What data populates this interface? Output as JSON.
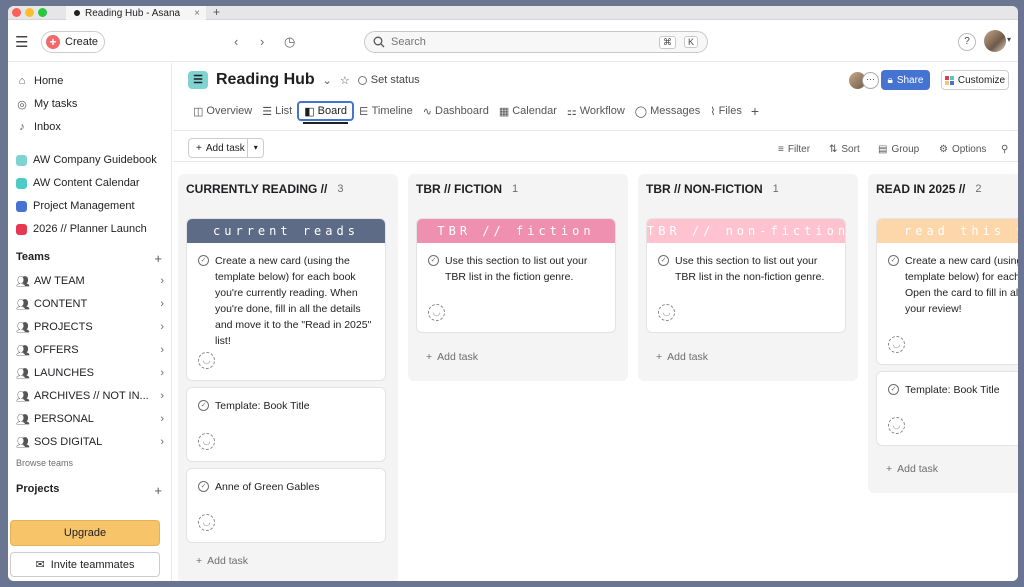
{
  "browser": {
    "tab_title": "Reading Hub - Asana"
  },
  "topbar": {
    "create_label": "Create",
    "search_placeholder": "Search",
    "kbd1": "⌘",
    "kbd2": "K",
    "help": "?"
  },
  "sidebar": {
    "top_items": [
      {
        "label": "Home",
        "icon": "home-icon"
      },
      {
        "label": "My tasks",
        "icon": "check-circle-icon"
      },
      {
        "label": "Inbox",
        "icon": "bell-icon"
      }
    ],
    "projects_top": [
      {
        "label": "AW Company Guidebook",
        "color": "#7fd3d1"
      },
      {
        "label": "AW Content Calendar",
        "color": "#4ecbc4"
      },
      {
        "label": "Project Management",
        "color": "#4573d2"
      },
      {
        "label": "2026 // Planner Launch",
        "color": "#e8384f"
      }
    ],
    "teams_title": "Teams",
    "teams": [
      "AW TEAM",
      "CONTENT",
      "PROJECTS",
      "OFFERS",
      "LAUNCHES",
      "ARCHIVES // NOT IN...",
      "PERSONAL",
      "SOS DIGITAL"
    ],
    "browse_teams": "Browse teams",
    "projects_title": "Projects",
    "upgrade": "Upgrade",
    "invite": "Invite teammates"
  },
  "project": {
    "title": "Reading Hub",
    "set_status": "Set status",
    "share": "Share",
    "customize": "Customize",
    "tabs": [
      "Overview",
      "List",
      "Board",
      "Timeline",
      "Dashboard",
      "Calendar",
      "Workflow",
      "Messages",
      "Files"
    ],
    "active_tab": "Board"
  },
  "toolbar": {
    "add_task": "Add task",
    "filter": "Filter",
    "sort": "Sort",
    "group": "Group",
    "options": "Options"
  },
  "columns": [
    {
      "title": "CURRENTLY READING //",
      "count": "3",
      "banner": "current reads",
      "banner_color": "#5d6b86",
      "cards": [
        "Create a new card (using the template below) for each book you're currently reading. When you're done, fill in all the details and move it to the \"Read in 2025\" list!",
        "Template: Book Title",
        "Anne of Green Gables"
      ],
      "add_task": "Add task"
    },
    {
      "title": "TBR // FICTION",
      "count": "1",
      "banner": "TBR // fiction",
      "banner_color": "#f090b0",
      "cards": [
        "Use this section to list out your TBR list in the fiction genre."
      ],
      "add_task": "Add task"
    },
    {
      "title": "TBR // NON-FICTION",
      "count": "1",
      "banner": "TBR // non-fiction",
      "banner_color": "#ffc3cf",
      "cards": [
        "Use this section to list out your TBR list in the non-fiction genre."
      ],
      "add_task": "Add task"
    },
    {
      "title": "READ IN 2025 //",
      "count": "2",
      "banner": "read this y",
      "banner_color": "#fdd6aa",
      "cards": [
        "Create a new card (using the template below) for each boo Open the card to fill in all the and your review!",
        "Template: Book Title"
      ],
      "add_task": "Add task"
    }
  ]
}
